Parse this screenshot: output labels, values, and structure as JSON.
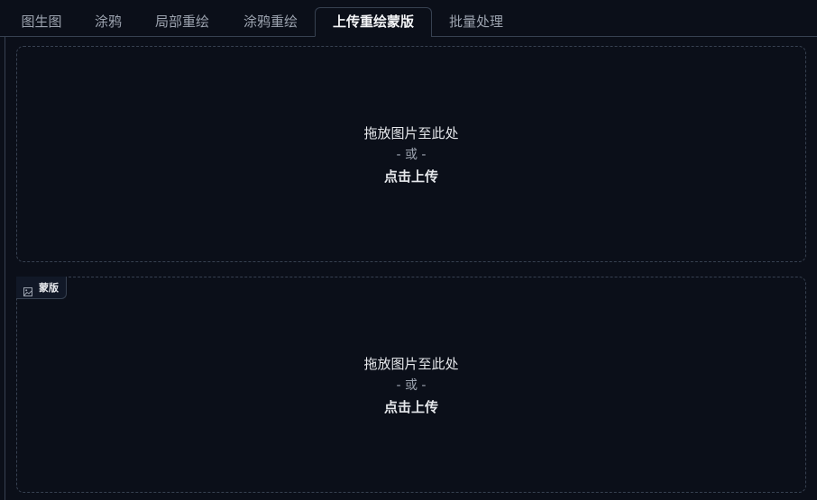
{
  "tabs": [
    {
      "label": "图生图",
      "active": false
    },
    {
      "label": "涂鸦",
      "active": false
    },
    {
      "label": "局部重绘",
      "active": false
    },
    {
      "label": "涂鸦重绘",
      "active": false
    },
    {
      "label": "上传重绘蒙版",
      "active": true
    },
    {
      "label": "批量处理",
      "active": false
    }
  ],
  "image_upload": {
    "drop_text": "拖放图片至此处",
    "or_text": "- 或 -",
    "click_text": "点击上传"
  },
  "mask_upload": {
    "label": "蒙版",
    "label_icon": "image-icon",
    "drop_text": "拖放图片至此处",
    "or_text": "- 或 -",
    "click_text": "点击上传"
  },
  "colors": {
    "background": "#0b0f19",
    "border": "#374151",
    "text_active": "#f3f4f6",
    "text_inactive": "#9ca3af"
  }
}
